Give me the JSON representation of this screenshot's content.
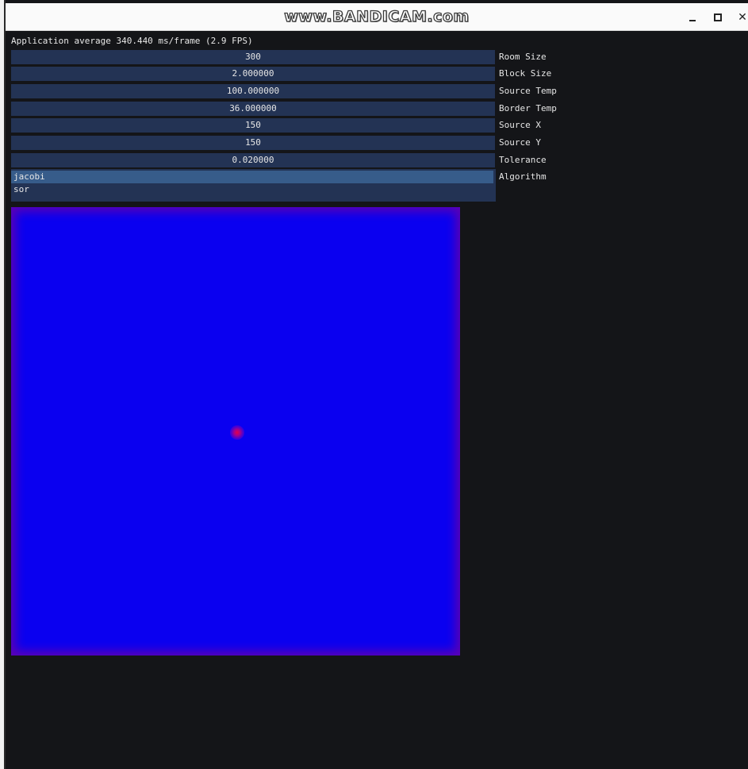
{
  "window": {
    "title_watermark": "www.BANDICAM.com",
    "controls": {
      "minimize_icon": "minimize-icon",
      "maximize_icon": "maximize-icon",
      "close_icon": "close-icon"
    }
  },
  "stats": {
    "fps_text": "Application average 340.440 ms/frame (2.9 FPS)"
  },
  "params": [
    {
      "value": "300",
      "label": "Room Size"
    },
    {
      "value": "2.000000",
      "label": "Block Size"
    },
    {
      "value": "100.000000",
      "label": "Source Temp"
    },
    {
      "value": "36.000000",
      "label": "Border Temp"
    },
    {
      "value": "150",
      "label": "Source X"
    },
    {
      "value": "150",
      "label": "Source Y"
    },
    {
      "value": "0.020000",
      "label": "Tolerance"
    }
  ],
  "algorithm": {
    "label": "Algorithm",
    "options": [
      "jacobi",
      "sor"
    ],
    "selected": "jacobi"
  },
  "colors": {
    "background": "#141518",
    "field_bg": "#233354",
    "selected_bg": "#375c8a",
    "heat_cold": "#0a00f0",
    "heat_border": "#5a00b4",
    "heat_hot": "#e2004a"
  }
}
